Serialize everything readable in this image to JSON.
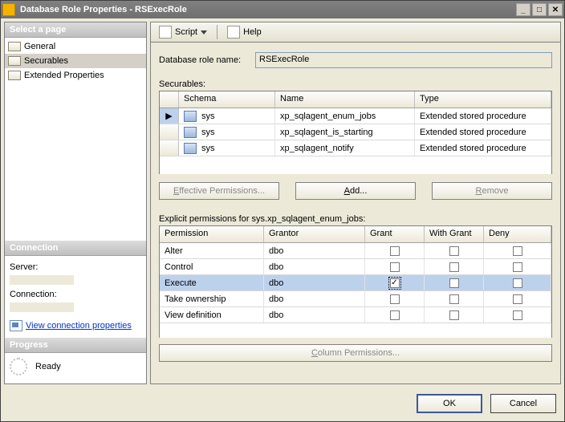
{
  "window": {
    "title": "Database Role Properties - RSExecRole"
  },
  "sidebar": {
    "header": "Select a page",
    "items": [
      {
        "label": "General"
      },
      {
        "label": "Securables"
      },
      {
        "label": "Extended Properties"
      }
    ]
  },
  "connection": {
    "header": "Connection",
    "server_label": "Server:",
    "connection_label": "Connection:",
    "link_label": "View connection properties"
  },
  "progress": {
    "header": "Progress",
    "status": "Ready"
  },
  "toolbar": {
    "script_label": "Script",
    "help_label": "Help"
  },
  "form": {
    "role_name_label": "Database role name:",
    "role_name_value": "RSExecRole",
    "securables_label": "Securables:",
    "explicit_label": "Explicit permissions for sys.xp_sqlagent_enum_jobs:"
  },
  "securables": {
    "columns": {
      "schema": "Schema",
      "name": "Name",
      "type": "Type"
    },
    "rows": [
      {
        "schema": "sys",
        "name": "xp_sqlagent_enum_jobs",
        "type": "Extended stored procedure",
        "selected": true
      },
      {
        "schema": "sys",
        "name": "xp_sqlagent_is_starting",
        "type": "Extended stored procedure",
        "selected": false
      },
      {
        "schema": "sys",
        "name": "xp_sqlagent_notify",
        "type": "Extended stored procedure",
        "selected": false
      }
    ]
  },
  "buttons": {
    "effective": "Effective Permissions...",
    "add": "Add...",
    "remove": "Remove",
    "column_permissions": "Column Permissions...",
    "ok": "OK",
    "cancel": "Cancel"
  },
  "permissions": {
    "columns": {
      "perm": "Permission",
      "grantor": "Grantor",
      "grant": "Grant",
      "withgrant": "With Grant",
      "deny": "Deny"
    },
    "rows": [
      {
        "perm": "Alter",
        "grantor": "dbo",
        "grant": false,
        "withgrant": false,
        "deny": false,
        "selected": false
      },
      {
        "perm": "Control",
        "grantor": "dbo",
        "grant": false,
        "withgrant": false,
        "deny": false,
        "selected": false
      },
      {
        "perm": "Execute",
        "grantor": "dbo",
        "grant": true,
        "withgrant": false,
        "deny": false,
        "selected": true
      },
      {
        "perm": "Take ownership",
        "grantor": "dbo",
        "grant": false,
        "withgrant": false,
        "deny": false,
        "selected": false
      },
      {
        "perm": "View definition",
        "grantor": "dbo",
        "grant": false,
        "withgrant": false,
        "deny": false,
        "selected": false
      }
    ]
  }
}
